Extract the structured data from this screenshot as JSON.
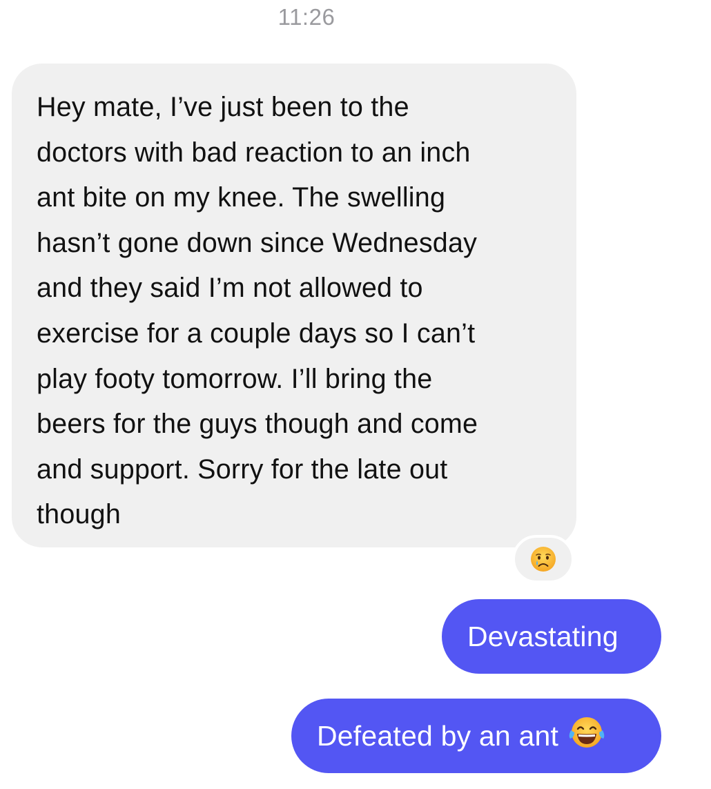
{
  "timestamp": "11:26",
  "incoming_message": {
    "lines": [
      "Hey mate, I’ve just been to the",
      "doctors with bad reaction to an inch",
      "ant bite on my knee. The swelling",
      "hasn’t gone down since Wednesday",
      "and they said I’m not allowed to",
      "exercise for a couple days so I can’t",
      "play footy tomorrow. I’ll bring the",
      "beers for the guys though and come",
      "and support. Sorry for the late out",
      "though"
    ],
    "reaction_icon": "crying-face-icon"
  },
  "outgoing_messages": [
    {
      "text": "Devastating"
    },
    {
      "text": "Defeated by an ant",
      "emoji_icon": "face-with-tears-of-joy-icon"
    }
  ],
  "colors": {
    "incoming_bubble": "#f0f0f0",
    "outgoing_bubble": "#5356f3",
    "timestamp_text": "#9a9a9e"
  }
}
